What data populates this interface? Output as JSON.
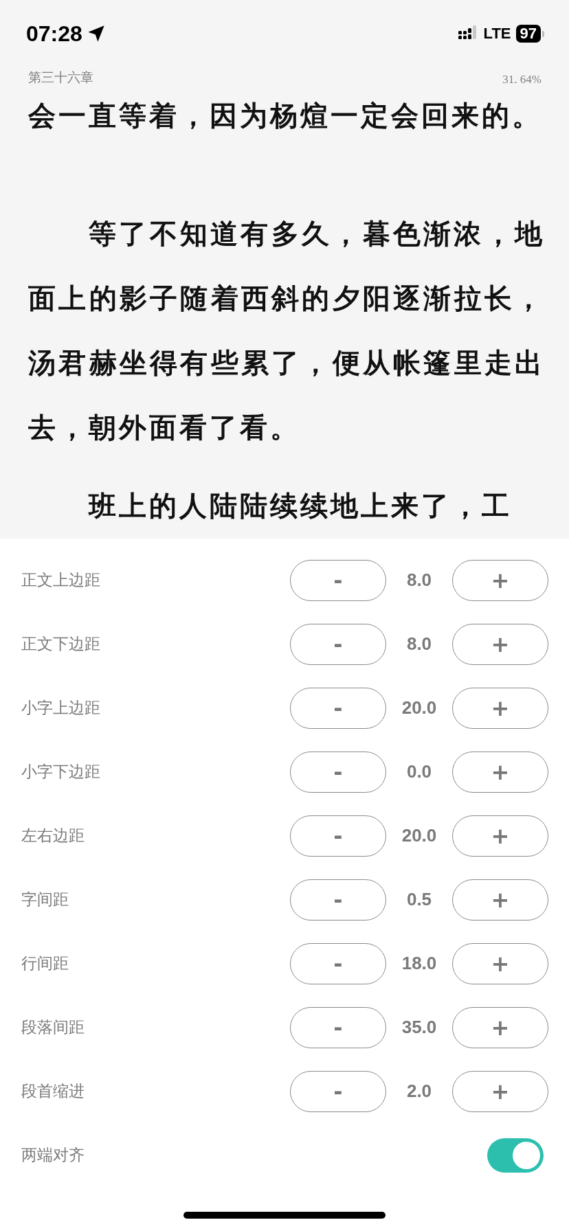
{
  "status_bar": {
    "time": "07:28",
    "network": "LTE",
    "battery": "97"
  },
  "reader": {
    "chapter": "第三十六章",
    "progress": "31. 64%",
    "paragraphs": [
      "会一直等着，因为杨煊一定会回来的。",
      "等了不知道有多久，暮色渐浓，地面上的影子随着西斜的夕阳逐渐拉长，汤君赫坐得有些累了，便从帐篷里走出去，朝外面看了看。",
      "班上的人陆陆续续地上来了，工"
    ]
  },
  "settings": [
    {
      "kind": "stepper",
      "label": "正文上边距",
      "value": "8.0",
      "minus": "-",
      "plus": "+"
    },
    {
      "kind": "stepper",
      "label": "正文下边距",
      "value": "8.0",
      "minus": "-",
      "plus": "+"
    },
    {
      "kind": "stepper",
      "label": "小字上边距",
      "value": "20.0",
      "minus": "-",
      "plus": "+"
    },
    {
      "kind": "stepper",
      "label": "小字下边距",
      "value": "0.0",
      "minus": "-",
      "plus": "+"
    },
    {
      "kind": "stepper",
      "label": "左右边距",
      "value": "20.0",
      "minus": "-",
      "plus": "+"
    },
    {
      "kind": "stepper",
      "label": "字间距",
      "value": "0.5",
      "minus": "-",
      "plus": "+"
    },
    {
      "kind": "stepper",
      "label": "行间距",
      "value": "18.0",
      "minus": "-",
      "plus": "+"
    },
    {
      "kind": "stepper",
      "label": "段落间距",
      "value": "35.0",
      "minus": "-",
      "plus": "+"
    },
    {
      "kind": "stepper",
      "label": "段首缩进",
      "value": "2.0",
      "minus": "-",
      "plus": "+"
    },
    {
      "kind": "toggle",
      "label": "两端对齐",
      "on": true
    }
  ]
}
